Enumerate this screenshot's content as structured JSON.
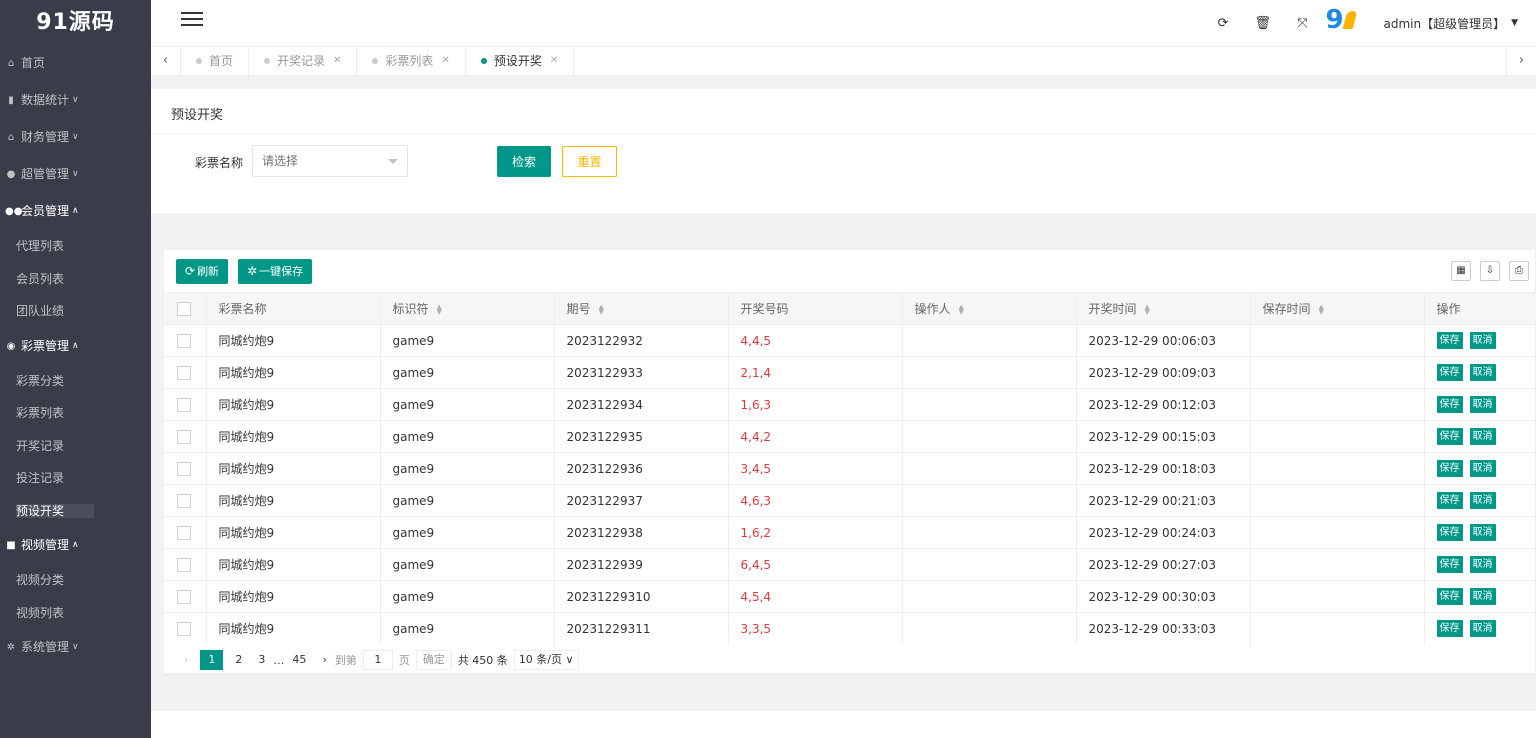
{
  "logo": "91源码",
  "sidebar": {
    "home": "首页",
    "groups": [
      {
        "label": "数据统计",
        "icon": "bar-chart-icon",
        "open": false
      },
      {
        "label": "财务管理",
        "icon": "bank-icon",
        "open": false
      },
      {
        "label": "超管管理",
        "icon": "user-icon",
        "open": false
      },
      {
        "label": "会员管理",
        "icon": "users-icon",
        "open": true
      }
    ],
    "member_items": [
      "代理列表",
      "会员列表",
      "团队业绩"
    ],
    "lottery_group": "彩票管理",
    "lottery_items": [
      "彩票分类",
      "彩票列表",
      "开奖记录",
      "投注记录",
      "预设开奖"
    ],
    "video_group": "视频管理",
    "video_items": [
      "视频分类",
      "视频列表"
    ],
    "system_group": "系统管理"
  },
  "header": {
    "user": "admin【超级管理员】"
  },
  "tabs": [
    {
      "label": "首页",
      "closable": false,
      "active": false
    },
    {
      "label": "开奖记录",
      "closable": true,
      "active": false
    },
    {
      "label": "彩票列表",
      "closable": true,
      "active": false
    },
    {
      "label": "预设开奖",
      "closable": true,
      "active": true
    }
  ],
  "search": {
    "title": "预设开奖",
    "lottery_label": "彩票名称",
    "select_placeholder": "请选择",
    "search_btn": "检索",
    "reset_btn": "重置"
  },
  "toolbar": {
    "refresh": "刷新",
    "save_all": "一键保存"
  },
  "table": {
    "columns": [
      "彩票名称",
      "标识符",
      "期号",
      "开奖号码",
      "操作人",
      "开奖时间",
      "保存时间",
      "操作"
    ],
    "rows": [
      [
        "同城约炮9",
        "game9",
        "2023122932",
        "4,4,5",
        "",
        "2023-12-29 00:06:03",
        ""
      ],
      [
        "同城约炮9",
        "game9",
        "2023122933",
        "2,1,4",
        "",
        "2023-12-29 00:09:03",
        ""
      ],
      [
        "同城约炮9",
        "game9",
        "2023122934",
        "1,6,3",
        "",
        "2023-12-29 00:12:03",
        ""
      ],
      [
        "同城约炮9",
        "game9",
        "2023122935",
        "4,4,2",
        "",
        "2023-12-29 00:15:03",
        ""
      ],
      [
        "同城约炮9",
        "game9",
        "2023122936",
        "3,4,5",
        "",
        "2023-12-29 00:18:03",
        ""
      ],
      [
        "同城约炮9",
        "game9",
        "2023122937",
        "4,6,3",
        "",
        "2023-12-29 00:21:03",
        ""
      ],
      [
        "同城约炮9",
        "game9",
        "2023122938",
        "1,6,2",
        "",
        "2023-12-29 00:24:03",
        ""
      ],
      [
        "同城约炮9",
        "game9",
        "2023122939",
        "6,4,5",
        "",
        "2023-12-29 00:27:03",
        ""
      ],
      [
        "同城约炮9",
        "game9",
        "20231229310",
        "4,5,4",
        "",
        "2023-12-29 00:30:03",
        ""
      ],
      [
        "同城约炮9",
        "game9",
        "20231229311",
        "3,3,5",
        "",
        "2023-12-29 00:33:03",
        ""
      ]
    ],
    "save_label": "保存",
    "cancel_label": "取消"
  },
  "pager": {
    "pages": [
      "1",
      "2",
      "3",
      "…",
      "45"
    ],
    "goto_label": "到第",
    "goto_value": "1",
    "page_unit": "页",
    "confirm": "确定",
    "total": "共 450 条",
    "page_size": "10 条/页"
  },
  "colors": {
    "primary": "#009688",
    "warn": "#ffb800",
    "sidebar": "#393d49",
    "draw_numbers": "#e4393c"
  }
}
